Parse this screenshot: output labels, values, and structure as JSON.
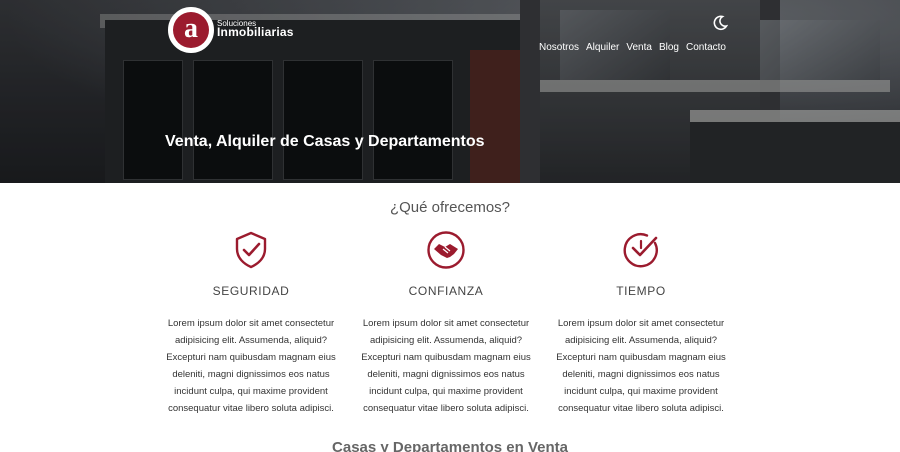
{
  "brand": {
    "small": "Soluciones",
    "name": "Inmobiliarias",
    "logo_letter": "a"
  },
  "nav": {
    "items": [
      "Nosotros",
      "Alquiler",
      "Venta",
      "Blog",
      "Contacto"
    ]
  },
  "hero": {
    "title": "Venta, Alquiler de Casas y Departamentos"
  },
  "offers": {
    "title": "¿Qué ofrecemos?",
    "items": [
      {
        "icon": "shield-check-icon",
        "title": "SEGURIDAD",
        "text": "Lorem ipsum dolor sit amet consectetur adipisicing elit. Assumenda, aliquid? Excepturi nam quibusdam magnam eius deleniti, magni dignissimos eos natus incidunt culpa, qui maxime provident consequatur vitae libero soluta adipisci."
      },
      {
        "icon": "handshake-icon",
        "title": "CONFIANZA",
        "text": "Lorem ipsum dolor sit amet consectetur adipisicing elit. Assumenda, aliquid? Excepturi nam quibusdam magnam eius deleniti, magni dignissimos eos natus incidunt culpa, qui maxime provident consequatur vitae libero soluta adipisci."
      },
      {
        "icon": "clock-check-icon",
        "title": "TIEMPO",
        "text": "Lorem ipsum dolor sit amet consectetur adipisicing elit. Assumenda, aliquid? Excepturi nam quibusdam magnam eius deleniti, magni dignissimos eos natus incidunt culpa, qui maxime provident consequatur vitae libero soluta adipisci."
      }
    ]
  },
  "sale_section": {
    "title": "Casas y Departamentos en Venta"
  },
  "colors": {
    "accent": "#9b1b2e"
  }
}
